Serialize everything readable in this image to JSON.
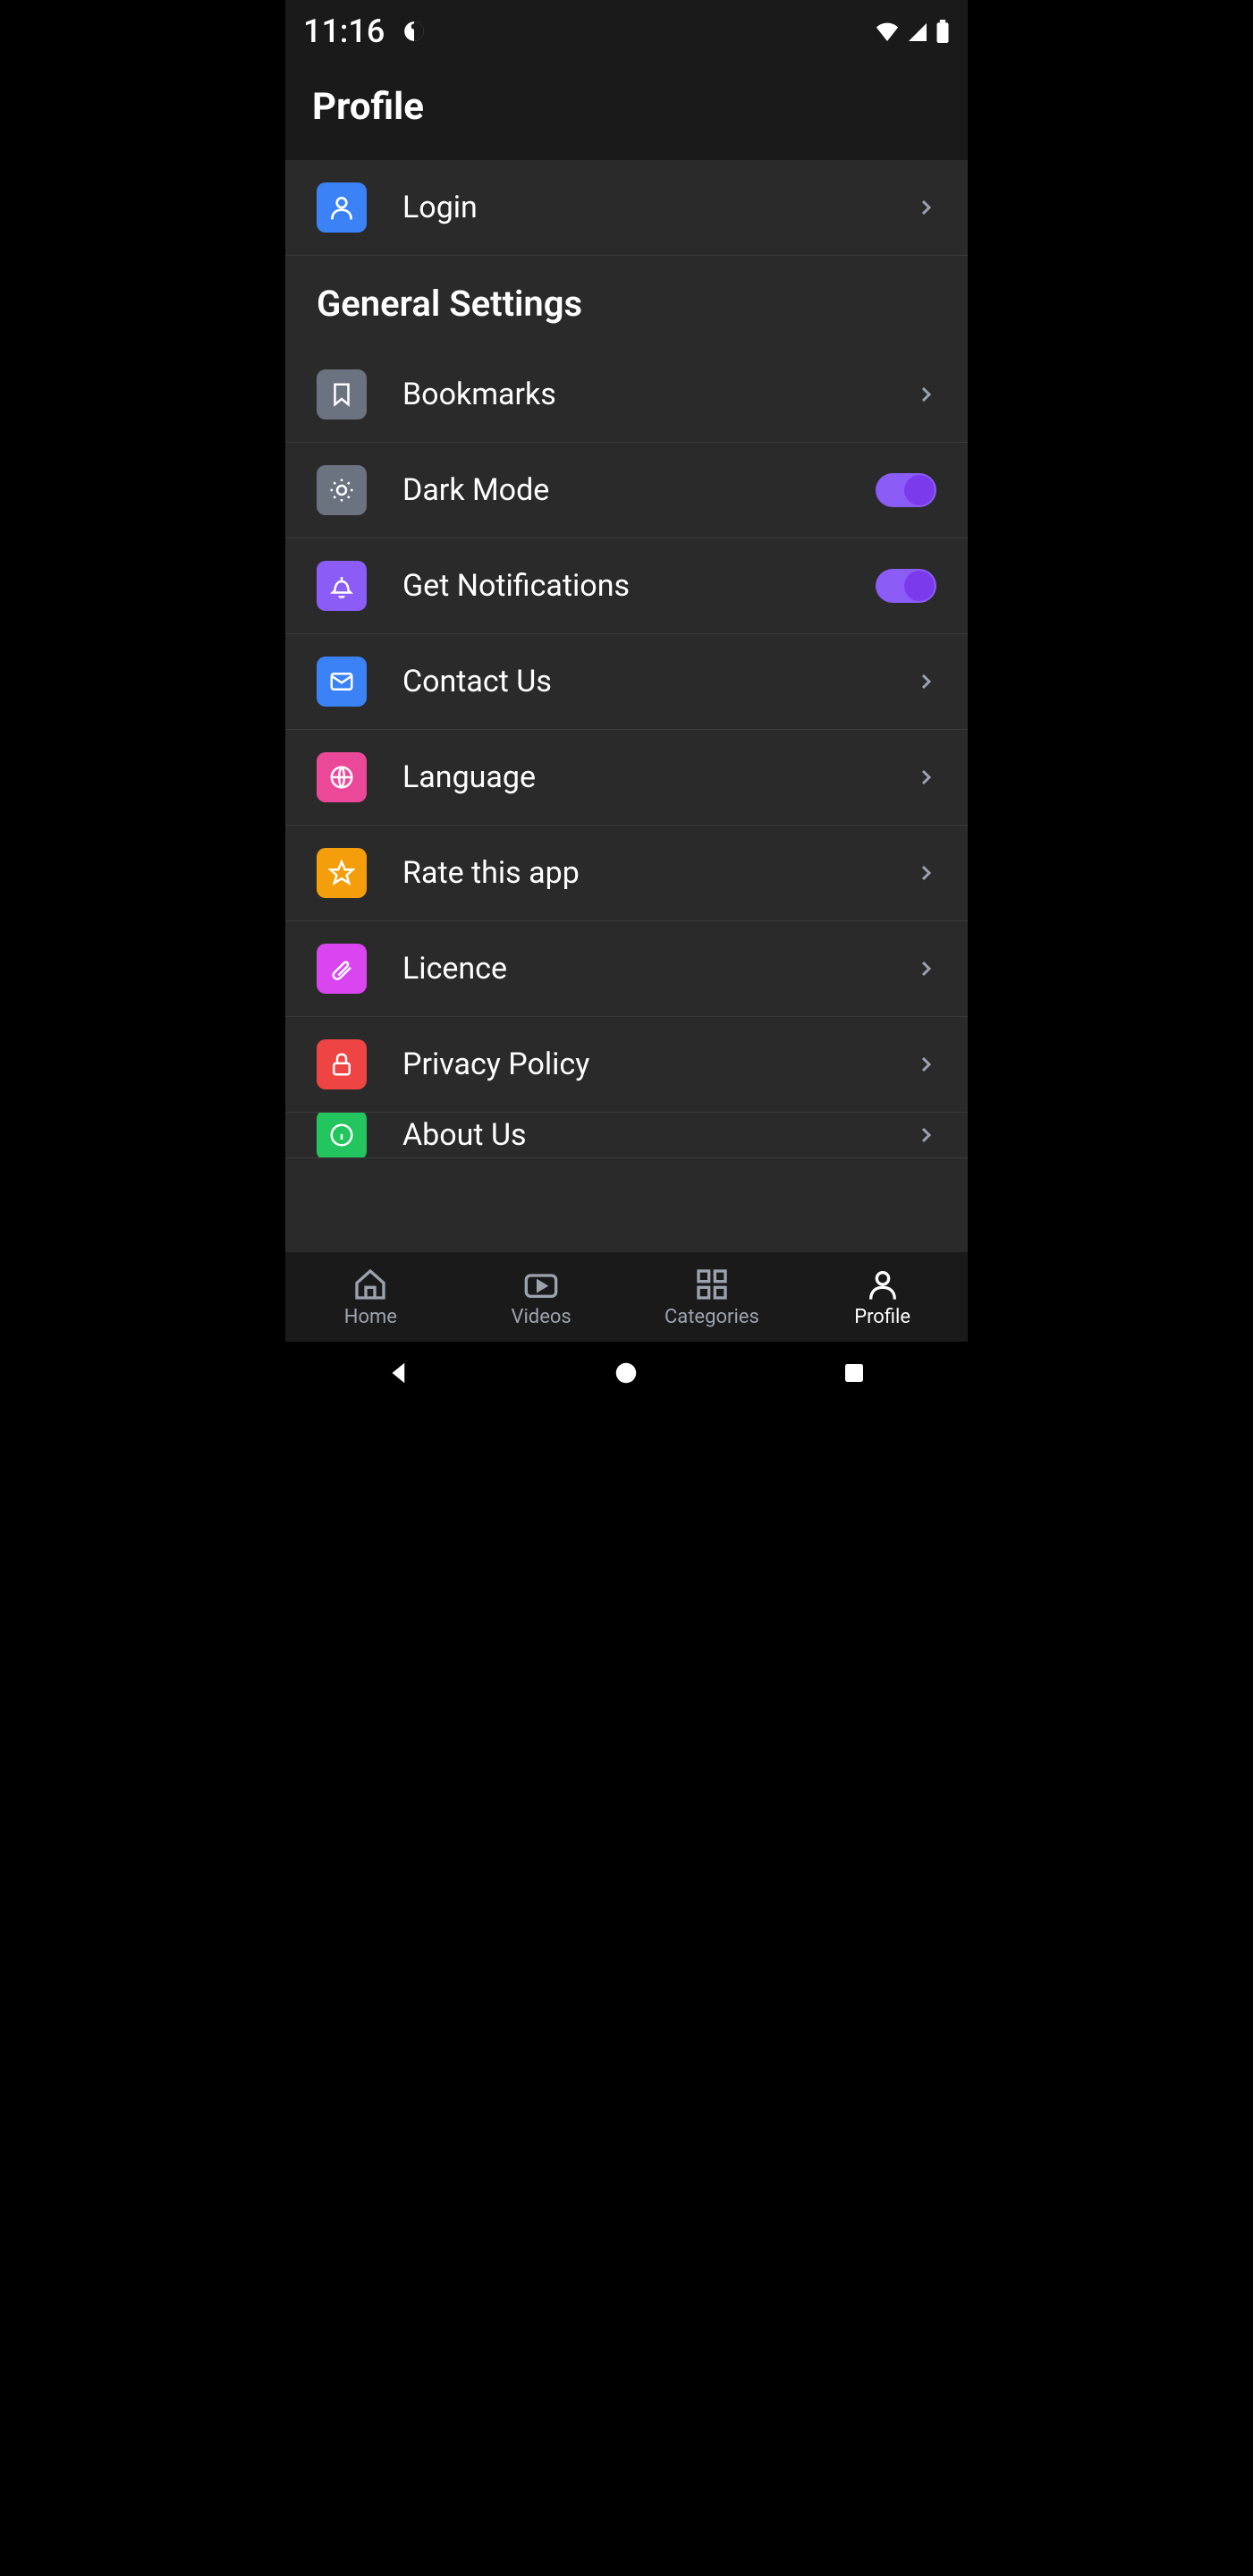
{
  "status": {
    "time": "11:16"
  },
  "header": {
    "title": "Profile"
  },
  "login": {
    "label": "Login"
  },
  "section": {
    "title": "General Settings"
  },
  "items": {
    "bookmarks": {
      "label": "Bookmarks"
    },
    "darkmode": {
      "label": "Dark Mode",
      "on": true
    },
    "notifications": {
      "label": "Get Notifications",
      "on": true
    },
    "contact": {
      "label": "Contact Us"
    },
    "language": {
      "label": "Language"
    },
    "rate": {
      "label": "Rate this app"
    },
    "licence": {
      "label": "Licence"
    },
    "privacy": {
      "label": "Privacy Policy"
    },
    "about": {
      "label": "About Us"
    }
  },
  "nav": {
    "home": "Home",
    "videos": "Videos",
    "categories": "Categories",
    "profile": "Profile"
  }
}
